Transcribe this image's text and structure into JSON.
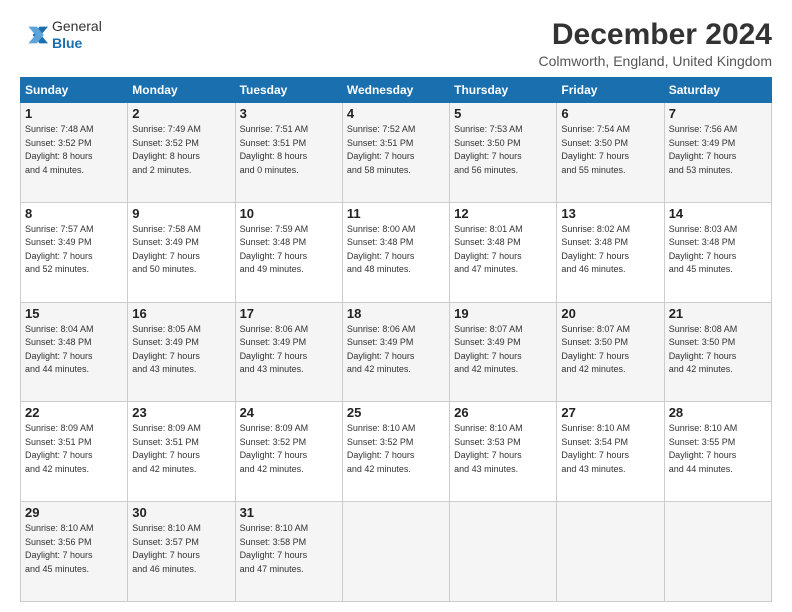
{
  "header": {
    "logo": {
      "general": "General",
      "blue": "Blue"
    },
    "title": "December 2024",
    "location": "Colmworth, England, United Kingdom"
  },
  "calendar": {
    "days_of_week": [
      "Sunday",
      "Monday",
      "Tuesday",
      "Wednesday",
      "Thursday",
      "Friday",
      "Saturday"
    ],
    "weeks": [
      [
        {
          "day": "",
          "info": ""
        },
        {
          "day": "2",
          "info": "Sunrise: 7:49 AM\nSunset: 3:52 PM\nDaylight: 8 hours\nand 2 minutes."
        },
        {
          "day": "3",
          "info": "Sunrise: 7:51 AM\nSunset: 3:51 PM\nDaylight: 8 hours\nand 0 minutes."
        },
        {
          "day": "4",
          "info": "Sunrise: 7:52 AM\nSunset: 3:51 PM\nDaylight: 7 hours\nand 58 minutes."
        },
        {
          "day": "5",
          "info": "Sunrise: 7:53 AM\nSunset: 3:50 PM\nDaylight: 7 hours\nand 56 minutes."
        },
        {
          "day": "6",
          "info": "Sunrise: 7:54 AM\nSunset: 3:50 PM\nDaylight: 7 hours\nand 55 minutes."
        },
        {
          "day": "7",
          "info": "Sunrise: 7:56 AM\nSunset: 3:49 PM\nDaylight: 7 hours\nand 53 minutes."
        }
      ],
      [
        {
          "day": "8",
          "info": "Sunrise: 7:57 AM\nSunset: 3:49 PM\nDaylight: 7 hours\nand 52 minutes."
        },
        {
          "day": "9",
          "info": "Sunrise: 7:58 AM\nSunset: 3:49 PM\nDaylight: 7 hours\nand 50 minutes."
        },
        {
          "day": "10",
          "info": "Sunrise: 7:59 AM\nSunset: 3:48 PM\nDaylight: 7 hours\nand 49 minutes."
        },
        {
          "day": "11",
          "info": "Sunrise: 8:00 AM\nSunset: 3:48 PM\nDaylight: 7 hours\nand 48 minutes."
        },
        {
          "day": "12",
          "info": "Sunrise: 8:01 AM\nSunset: 3:48 PM\nDaylight: 7 hours\nand 47 minutes."
        },
        {
          "day": "13",
          "info": "Sunrise: 8:02 AM\nSunset: 3:48 PM\nDaylight: 7 hours\nand 46 minutes."
        },
        {
          "day": "14",
          "info": "Sunrise: 8:03 AM\nSunset: 3:48 PM\nDaylight: 7 hours\nand 45 minutes."
        }
      ],
      [
        {
          "day": "15",
          "info": "Sunrise: 8:04 AM\nSunset: 3:48 PM\nDaylight: 7 hours\nand 44 minutes."
        },
        {
          "day": "16",
          "info": "Sunrise: 8:05 AM\nSunset: 3:49 PM\nDaylight: 7 hours\nand 43 minutes."
        },
        {
          "day": "17",
          "info": "Sunrise: 8:06 AM\nSunset: 3:49 PM\nDaylight: 7 hours\nand 43 minutes."
        },
        {
          "day": "18",
          "info": "Sunrise: 8:06 AM\nSunset: 3:49 PM\nDaylight: 7 hours\nand 42 minutes."
        },
        {
          "day": "19",
          "info": "Sunrise: 8:07 AM\nSunset: 3:49 PM\nDaylight: 7 hours\nand 42 minutes."
        },
        {
          "day": "20",
          "info": "Sunrise: 8:07 AM\nSunset: 3:50 PM\nDaylight: 7 hours\nand 42 minutes."
        },
        {
          "day": "21",
          "info": "Sunrise: 8:08 AM\nSunset: 3:50 PM\nDaylight: 7 hours\nand 42 minutes."
        }
      ],
      [
        {
          "day": "22",
          "info": "Sunrise: 8:09 AM\nSunset: 3:51 PM\nDaylight: 7 hours\nand 42 minutes."
        },
        {
          "day": "23",
          "info": "Sunrise: 8:09 AM\nSunset: 3:51 PM\nDaylight: 7 hours\nand 42 minutes."
        },
        {
          "day": "24",
          "info": "Sunrise: 8:09 AM\nSunset: 3:52 PM\nDaylight: 7 hours\nand 42 minutes."
        },
        {
          "day": "25",
          "info": "Sunrise: 8:10 AM\nSunset: 3:52 PM\nDaylight: 7 hours\nand 42 minutes."
        },
        {
          "day": "26",
          "info": "Sunrise: 8:10 AM\nSunset: 3:53 PM\nDaylight: 7 hours\nand 43 minutes."
        },
        {
          "day": "27",
          "info": "Sunrise: 8:10 AM\nSunset: 3:54 PM\nDaylight: 7 hours\nand 43 minutes."
        },
        {
          "day": "28",
          "info": "Sunrise: 8:10 AM\nSunset: 3:55 PM\nDaylight: 7 hours\nand 44 minutes."
        }
      ],
      [
        {
          "day": "29",
          "info": "Sunrise: 8:10 AM\nSunset: 3:56 PM\nDaylight: 7 hours\nand 45 minutes."
        },
        {
          "day": "30",
          "info": "Sunrise: 8:10 AM\nSunset: 3:57 PM\nDaylight: 7 hours\nand 46 minutes."
        },
        {
          "day": "31",
          "info": "Sunrise: 8:10 AM\nSunset: 3:58 PM\nDaylight: 7 hours\nand 47 minutes."
        },
        {
          "day": "",
          "info": ""
        },
        {
          "day": "",
          "info": ""
        },
        {
          "day": "",
          "info": ""
        },
        {
          "day": "",
          "info": ""
        }
      ]
    ],
    "week1_day1": {
      "day": "1",
      "info": "Sunrise: 7:48 AM\nSunset: 3:52 PM\nDaylight: 8 hours\nand 4 minutes."
    }
  }
}
